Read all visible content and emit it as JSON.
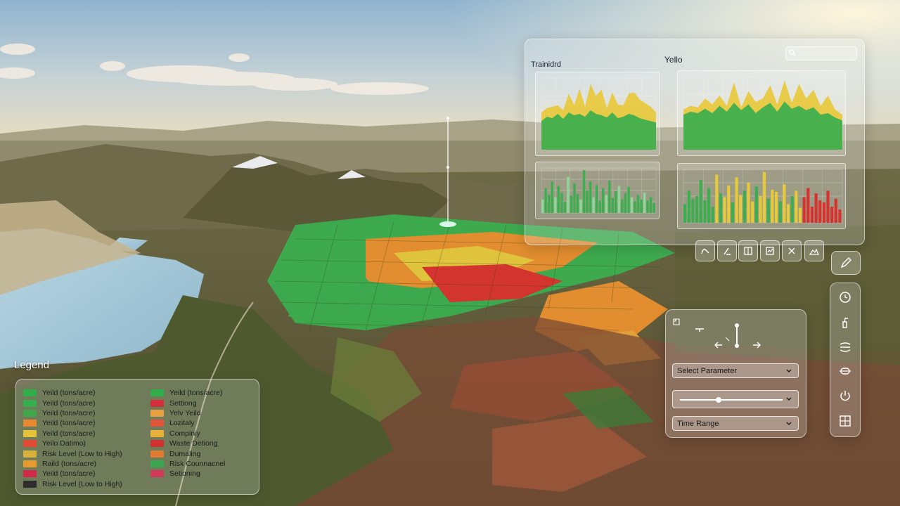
{
  "dashboard": {
    "title": "Trainidrd",
    "center_label": "Yello",
    "search_placeholder": "",
    "icon": "search-icon"
  },
  "legend": {
    "title": "Legend",
    "items": [
      {
        "label": "Yeild (tons/acre)",
        "color": "#2fae4a"
      },
      {
        "label": "Yeild (tons/acre)",
        "color": "#34b04e"
      },
      {
        "label": "Yeild (tons/acre)",
        "color": "#3fa84a"
      },
      {
        "label": "Yeild (tons/acre)",
        "color": "#e8892f"
      },
      {
        "label": "Yeild (tons/acre)",
        "color": "#e6c23a"
      },
      {
        "label": "Yeilo Datimo)",
        "color": "#e24a33"
      },
      {
        "label": "Risk Level (Low to High)",
        "color": "#d8b13a"
      },
      {
        "label": "Raild (tons/acre)",
        "color": "#e79a2e"
      },
      {
        "label": "Yeild (tons/acre)",
        "color": "#d2284a"
      },
      {
        "label": "Risk Level (Low to High)",
        "color": "#2e2e2e"
      },
      {
        "label": "Yeild (tons/acre)",
        "color": "#2fae4a"
      },
      {
        "label": "Settiong",
        "color": "#d52e3a"
      },
      {
        "label": "Yelv Yeild",
        "color": "#e8a040"
      },
      {
        "label": "Lozitaly",
        "color": "#e2553a"
      },
      {
        "label": "Compiniy",
        "color": "#e8b23a"
      },
      {
        "label": "Waste Detiong",
        "color": "#cf3030"
      },
      {
        "label": "Dumaling",
        "color": "#e07a2e"
      },
      {
        "label": "Risk Counnacnel",
        "color": "#3aa84e"
      },
      {
        "label": "Setioning",
        "color": "#d23a5a"
      }
    ]
  },
  "toolbar": {
    "icons": [
      "curve-tool-icon",
      "measure-tool-icon",
      "book-tool-icon",
      "chart-tool-icon",
      "close-tool-icon",
      "terrain-tool-icon"
    ],
    "pen_icon": "pen-icon"
  },
  "control_panel": {
    "select_parameter": "Select Parameter",
    "time_range": "Time Range",
    "slider_value": 0.38
  },
  "sidebar": {
    "icons": [
      "clock-icon",
      "spray-icon",
      "layers-icon",
      "swap-icon",
      "power-icon",
      "grid-icon"
    ]
  },
  "colors": {
    "green": "#3cae4f",
    "yellow": "#e7c93c",
    "orange": "#e9902f",
    "red": "#d9322e",
    "panel": "rgba(235,240,245,0.22)"
  },
  "chart_data": [
    {
      "type": "area",
      "title": "",
      "series": [
        {
          "name": "",
          "values": [
            52,
            58,
            60,
            62,
            55,
            78,
            62,
            85,
            60,
            92,
            75,
            84,
            58,
            80,
            63,
            62,
            78,
            80,
            70,
            65,
            60,
            52
          ]
        },
        {
          "name": "",
          "values": [
            40,
            46,
            44,
            50,
            43,
            52,
            48,
            50,
            46,
            55,
            50,
            48,
            45,
            52,
            44,
            46,
            50,
            48,
            44,
            42,
            40,
            38
          ]
        }
      ]
    },
    {
      "type": "area",
      "title": "",
      "series": [
        {
          "name": "",
          "values": [
            55,
            60,
            58,
            70,
            62,
            74,
            60,
            92,
            58,
            80,
            65,
            70,
            88,
            62,
            95,
            64,
            90,
            70,
            82,
            60,
            74,
            55,
            48
          ]
        },
        {
          "name": "",
          "values": [
            48,
            52,
            50,
            56,
            50,
            60,
            52,
            64,
            54,
            62,
            50,
            58,
            64,
            52,
            66,
            56,
            60,
            54,
            58,
            48,
            50,
            44,
            40
          ]
        }
      ]
    },
    {
      "type": "bar",
      "title": "",
      "series": [
        {
          "name": "",
          "values": [
            30,
            55,
            40,
            70,
            35,
            60,
            45,
            25,
            80,
            38,
            66,
            42,
            30,
            95,
            50,
            70,
            35,
            62,
            28,
            55,
            40,
            72,
            33,
            48,
            60,
            30,
            44,
            58,
            35,
            26,
            40,
            30,
            45,
            28,
            35,
            22
          ]
        }
      ]
    },
    {
      "type": "bar",
      "title": "",
      "series": [
        {
          "name": "",
          "values": [
            35,
            60,
            45,
            50,
            80,
            42,
            65,
            30,
            90,
            55,
            48,
            70,
            38,
            85,
            52,
            60,
            75,
            40,
            68,
            50,
            95,
            45,
            62,
            58,
            40,
            72,
            35,
            50,
            60,
            28,
            48,
            65,
            30,
            55,
            42,
            38,
            60,
            30,
            45,
            25
          ]
        }
      ]
    }
  ]
}
